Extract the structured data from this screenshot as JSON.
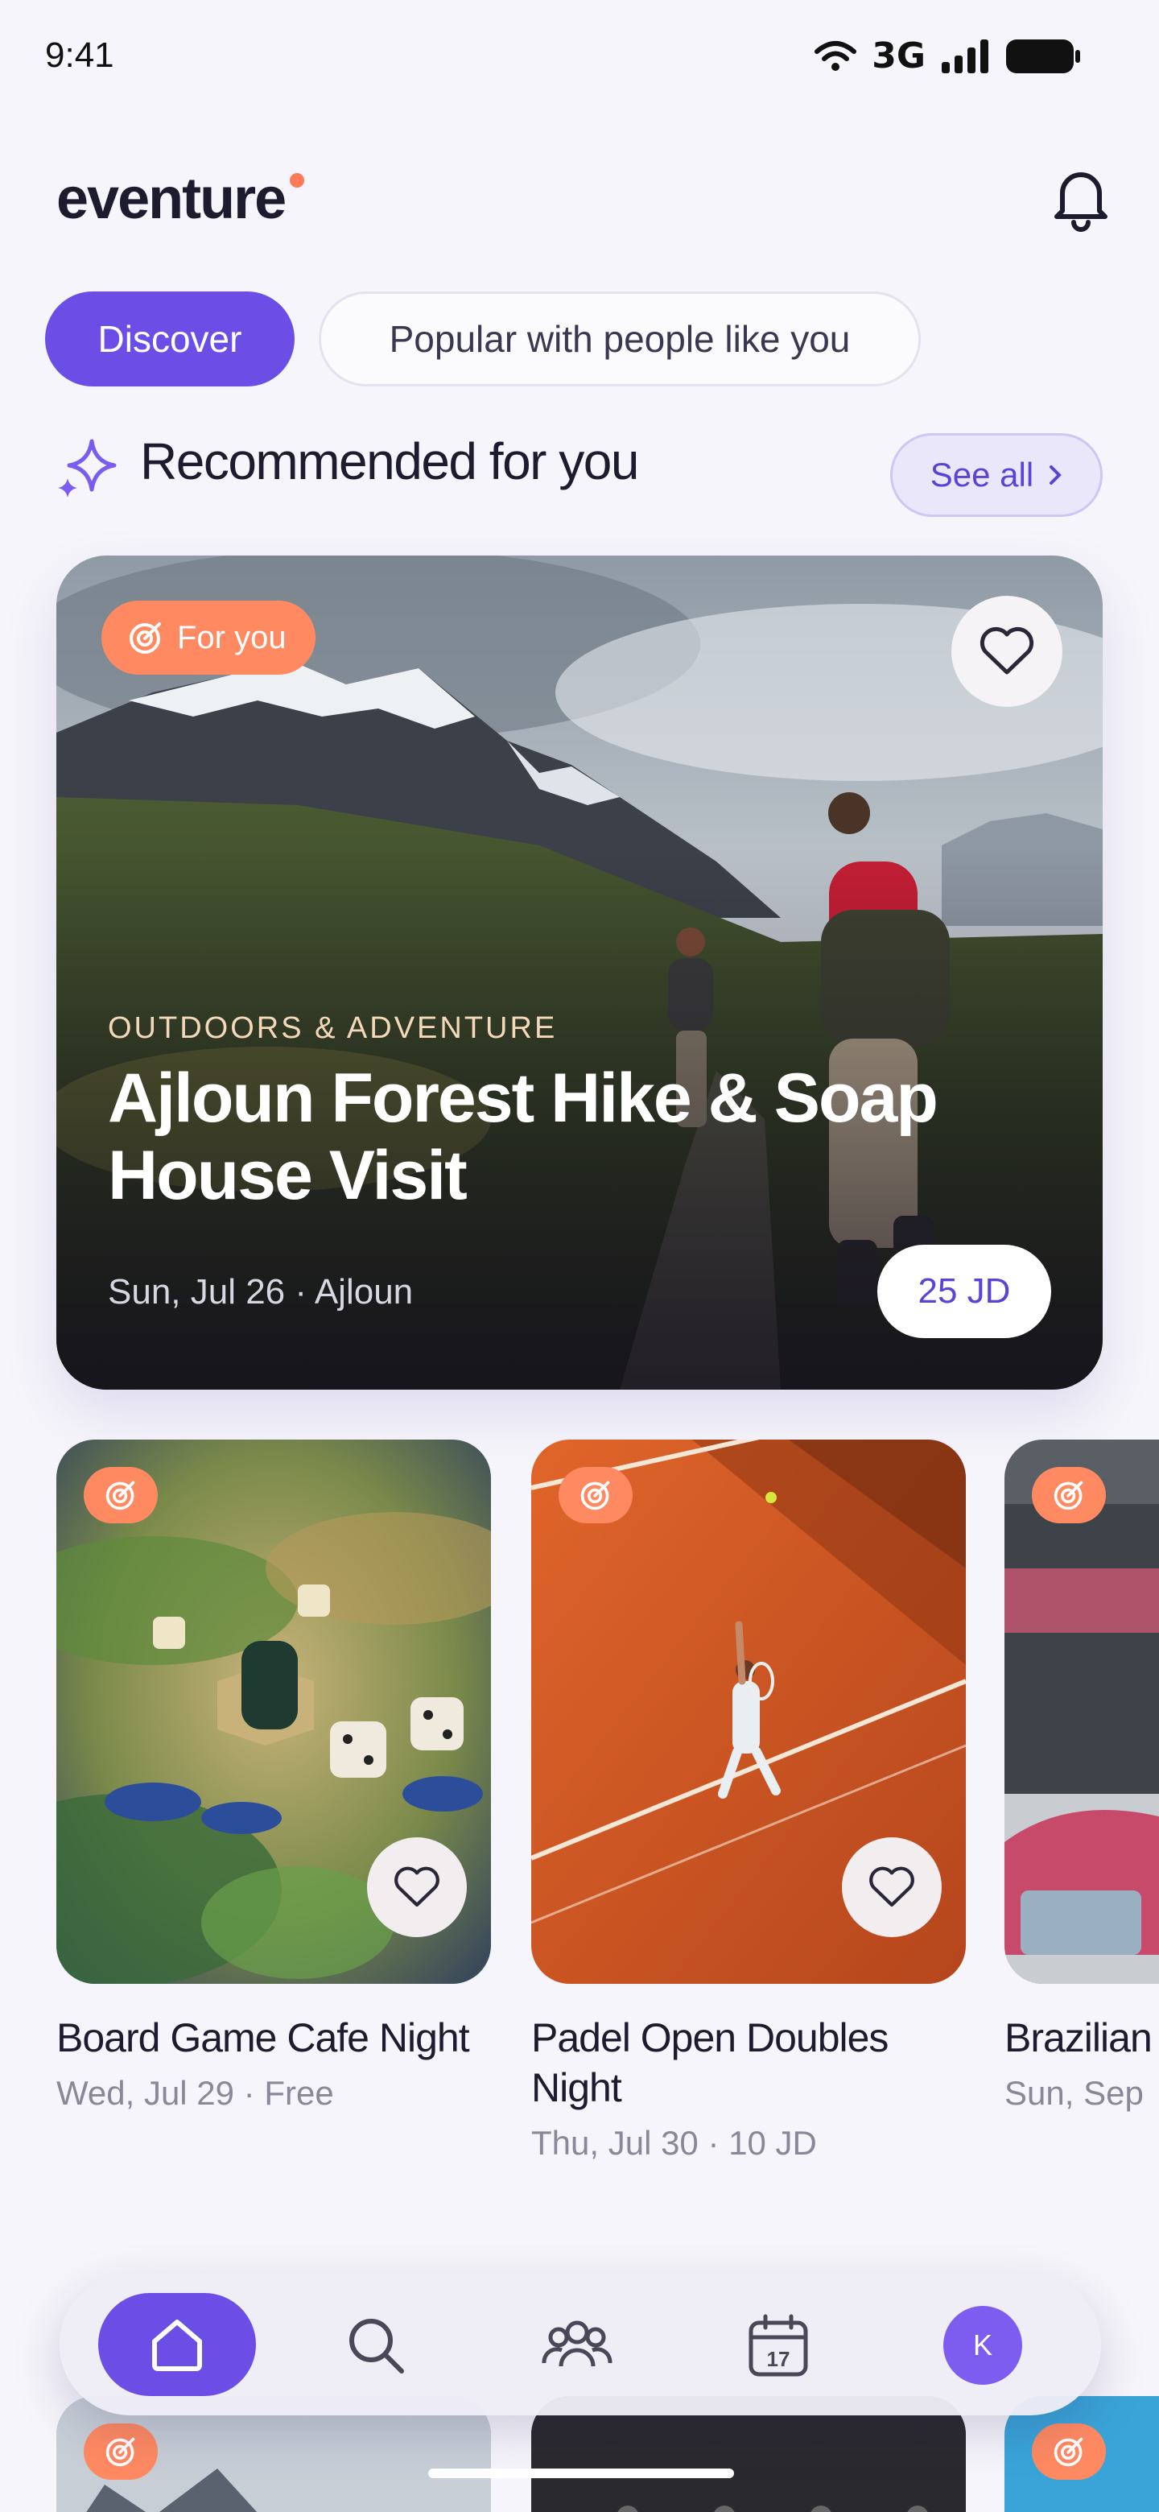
{
  "status_bar": {
    "time": "9:41",
    "network": "3G"
  },
  "header": {
    "logo": "eventure"
  },
  "tabs": [
    {
      "label": "Discover",
      "active": true
    },
    {
      "label": "Popular with people like you",
      "active": false
    }
  ],
  "section": {
    "title": "Recommended for you",
    "see_all": "See all"
  },
  "hero": {
    "badge": "For you",
    "category": "OUTDOORS & ADVENTURE",
    "title": "Ajloun Forest Hike & Soap House Visit",
    "meta": "Sun, Jul 26 · Ajloun",
    "price": "25 JD"
  },
  "cards": [
    {
      "title": "Board Game Cafe Night",
      "meta": "Wed, Jul 29 · Free"
    },
    {
      "title": "Padel Open Doubles Night",
      "meta": "Thu, Jul 30 · 10 JD"
    },
    {
      "title": "Brazilian Mat & Se",
      "meta": "Sun, Sep"
    }
  ],
  "nav": {
    "items": [
      "home-icon",
      "search-icon",
      "people-icon",
      "calendar-icon"
    ],
    "calendar_day": "17",
    "avatar_initial": "K"
  },
  "colors": {
    "accent": "#6a4ee6",
    "badge": "#ff8a62",
    "background": "#f6f5fb"
  }
}
